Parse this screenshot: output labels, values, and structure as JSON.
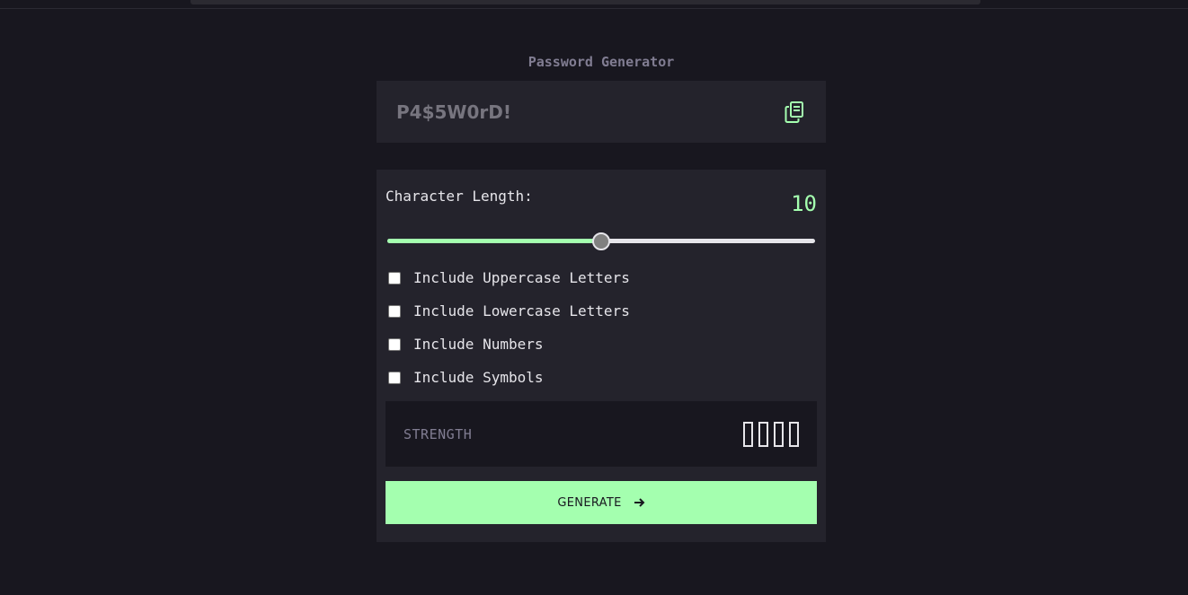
{
  "app": {
    "title": "Password Generator"
  },
  "password": {
    "value": "P4$5W0rD!",
    "copy_icon": "copy-icon"
  },
  "length": {
    "label": "Character Length:",
    "value": "10",
    "slider_fraction": 0.5
  },
  "options": [
    {
      "label": "Include Uppercase Letters",
      "checked": false
    },
    {
      "label": "Include Lowercase Letters",
      "checked": false
    },
    {
      "label": "Include Numbers",
      "checked": false
    },
    {
      "label": "Include Symbols",
      "checked": false
    }
  ],
  "strength": {
    "label": "STRENGTH",
    "bars_filled": 0,
    "bars_total": 4
  },
  "generate": {
    "label": "GENERATE",
    "icon": "arrow-right-icon"
  },
  "colors": {
    "background": "#18171f",
    "panel": "#24232c",
    "accent": "#a4ffaf",
    "text": "#e6e5ea",
    "muted": "#817d92"
  }
}
